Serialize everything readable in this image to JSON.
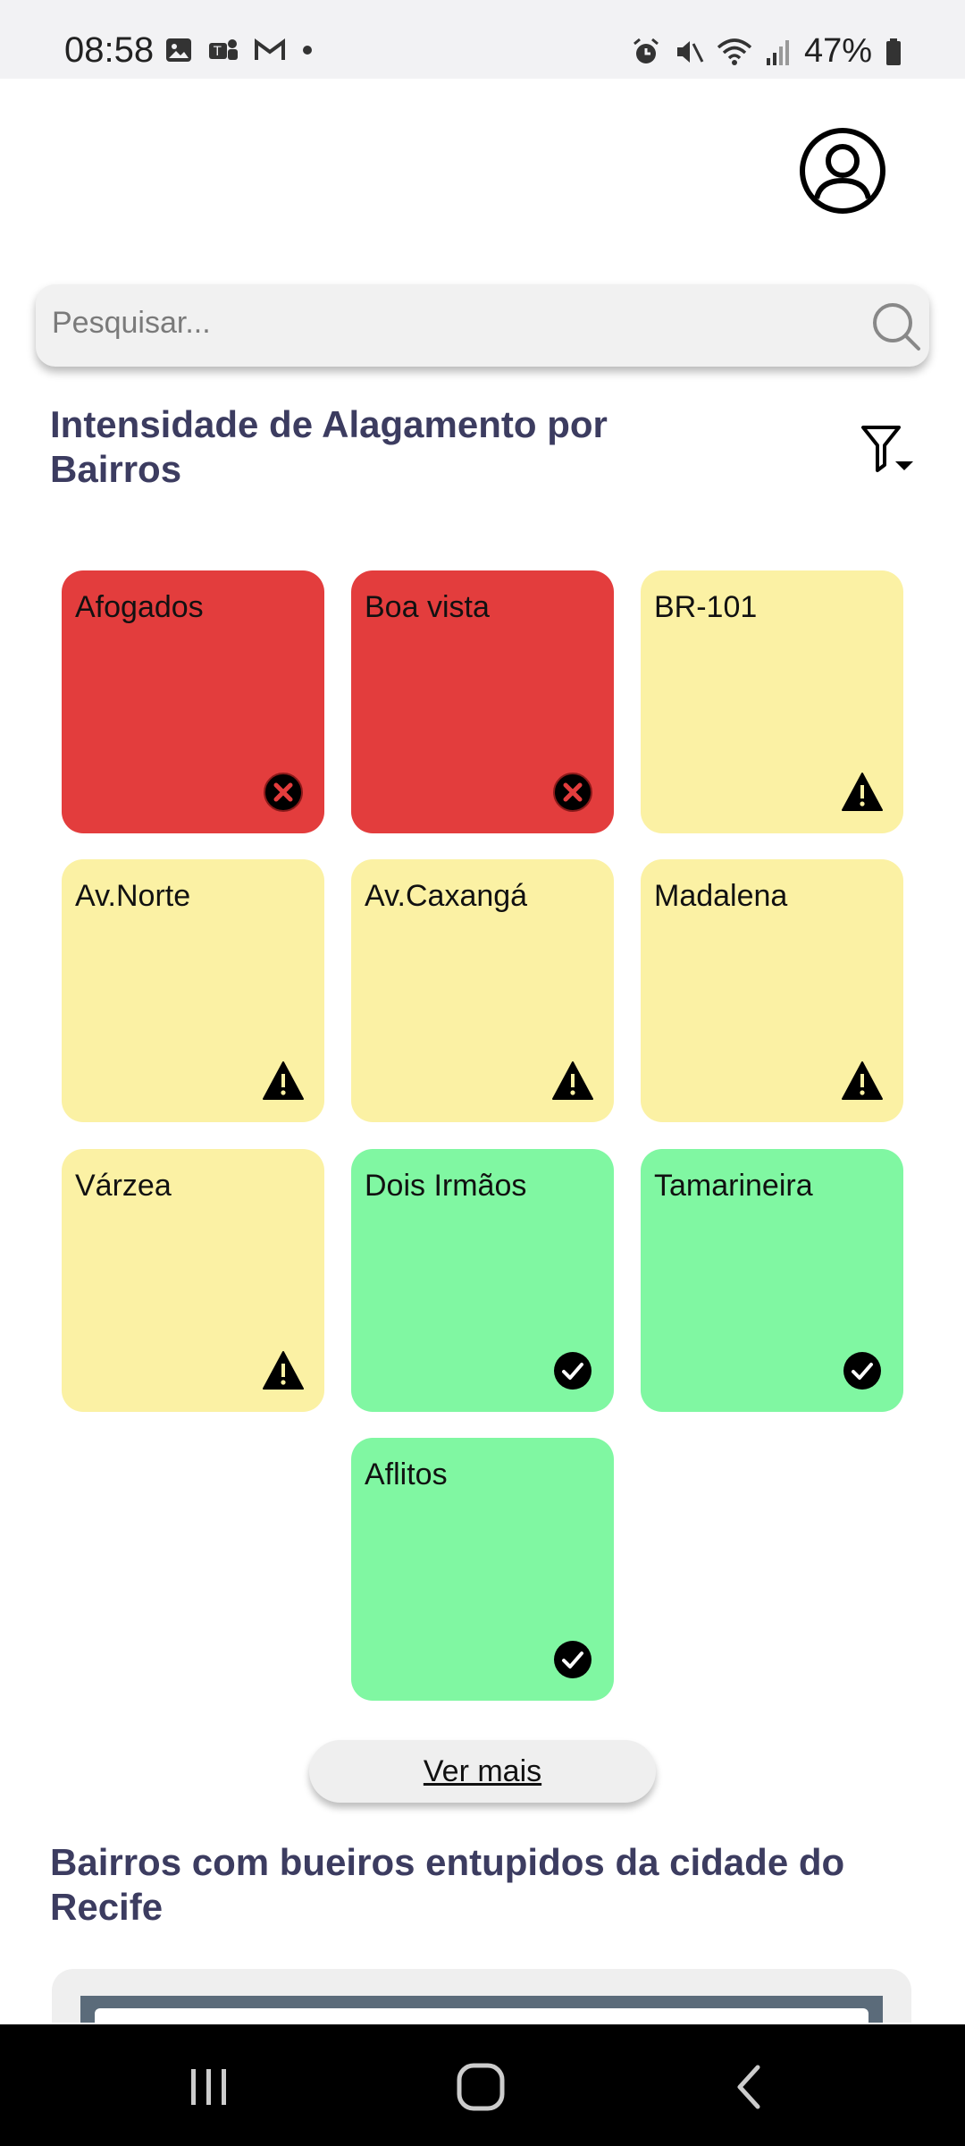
{
  "status_bar": {
    "time": "08:58",
    "battery": "47%"
  },
  "search": {
    "placeholder": "Pesquisar..."
  },
  "section1": {
    "title": "Intensidade de Alagamento por Bairros"
  },
  "section2": {
    "title": "Bairros com bueiros entupidos da cidade do Recife"
  },
  "colors": {
    "red": "#e33d3d",
    "yellow": "#fbf1a4",
    "green": "#80f7a2",
    "title": "#3c3c60"
  },
  "tiles": [
    {
      "label": "Afogados",
      "status": "red",
      "icon": "x-circle-icon"
    },
    {
      "label": "Boa vista",
      "status": "red",
      "icon": "x-circle-icon"
    },
    {
      "label": "BR-101",
      "status": "yellow",
      "icon": "warning-icon"
    },
    {
      "label": "Av.Norte",
      "status": "yellow",
      "icon": "warning-icon"
    },
    {
      "label": "Av.Caxangá",
      "status": "yellow",
      "icon": "warning-icon"
    },
    {
      "label": "Madalena",
      "status": "yellow",
      "icon": "warning-icon"
    },
    {
      "label": "Várzea",
      "status": "yellow",
      "icon": "warning-icon"
    },
    {
      "label": "Dois Irmãos",
      "status": "green",
      "icon": "check-circle-icon"
    },
    {
      "label": "Tamarineira",
      "status": "green",
      "icon": "check-circle-icon"
    },
    {
      "label": "Aflitos",
      "status": "green",
      "icon": "check-circle-icon"
    }
  ],
  "more_button": {
    "label": "Ver mais"
  }
}
